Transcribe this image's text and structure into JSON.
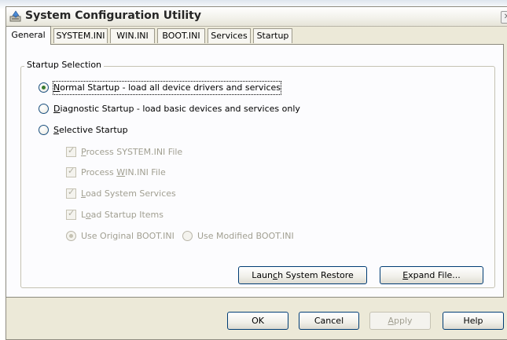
{
  "window": {
    "title": "System Configuration Utility",
    "close_symbol": "✕"
  },
  "tabs": [
    {
      "label": "General",
      "active": true
    },
    {
      "label": "SYSTEM.INI",
      "active": false
    },
    {
      "label": "WIN.INI",
      "active": false
    },
    {
      "label": "BOOT.INI",
      "active": false
    },
    {
      "label": "Services",
      "active": false
    },
    {
      "label": "Startup",
      "active": false
    }
  ],
  "startup": {
    "group_title": "Startup Selection",
    "normal": {
      "mnemonic": "N",
      "rest": "ormal Startup - load all device drivers and services",
      "checked": true
    },
    "diagnostic": {
      "mnemonic": "D",
      "rest": "iagnostic Startup - load basic devices and services only",
      "checked": false
    },
    "selective": {
      "mnemonic": "S",
      "rest": "elective Startup",
      "checked": false
    },
    "sub_options": [
      {
        "pre": "",
        "mnemonic": "P",
        "rest": "rocess SYSTEM.INI File",
        "checked": true,
        "enabled": false
      },
      {
        "pre": "Process ",
        "mnemonic": "W",
        "rest": "IN.INI File",
        "checked": true,
        "enabled": false
      },
      {
        "pre": "",
        "mnemonic": "L",
        "rest": "oad System Services",
        "checked": true,
        "enabled": false
      },
      {
        "pre": "L",
        "mnemonic": "o",
        "rest": "ad Startup Items",
        "checked": true,
        "enabled": false
      }
    ],
    "boot_original": {
      "label": "Use Original BOOT.INI",
      "checked": true,
      "enabled": false
    },
    "boot_modified": {
      "label": "Use Modified BOOT.INI",
      "checked": false,
      "enabled": false
    }
  },
  "actions": {
    "launch_restore": {
      "pre": "Laun",
      "mnemonic": "c",
      "rest": "h System Restore"
    },
    "expand_file": {
      "pre": "",
      "mnemonic": "E",
      "rest": "xpand File..."
    }
  },
  "footer": {
    "ok": "OK",
    "cancel": "Cancel",
    "apply": {
      "mnemonic": "A",
      "rest": "pply",
      "enabled": false
    },
    "help": "Help"
  }
}
